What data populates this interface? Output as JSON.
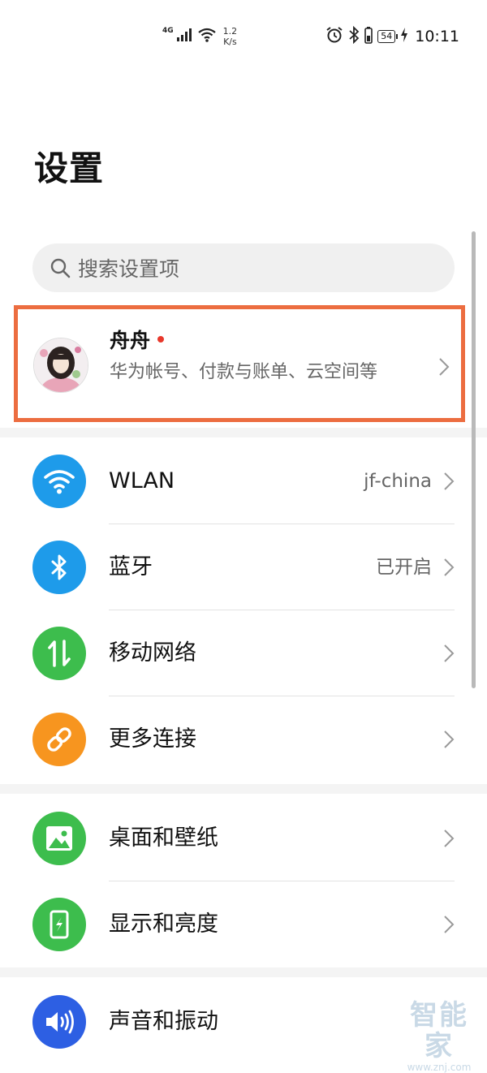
{
  "status_bar": {
    "network_label": "4G",
    "speed_value": "1.2",
    "speed_unit": "K/s",
    "battery": "54",
    "time": "10:11"
  },
  "page_title": "设置",
  "search": {
    "placeholder": "搜索设置项"
  },
  "account": {
    "name": "舟舟",
    "description": "华为帐号、付款与账单、云空间等"
  },
  "sections": [
    {
      "items": [
        {
          "label": "WLAN",
          "value": "jf-china",
          "icon": "wifi-icon",
          "color": "#1e9bea"
        },
        {
          "label": "蓝牙",
          "value": "已开启",
          "icon": "bluetooth-icon",
          "color": "#1e9bea"
        },
        {
          "label": "移动网络",
          "value": "",
          "icon": "mobile-network-icon",
          "color": "#3dbd4d"
        },
        {
          "label": "更多连接",
          "value": "",
          "icon": "link-icon",
          "color": "#f7951f"
        }
      ]
    },
    {
      "items": [
        {
          "label": "桌面和壁纸",
          "value": "",
          "icon": "wallpaper-icon",
          "color": "#3dbd4d"
        },
        {
          "label": "显示和亮度",
          "value": "",
          "icon": "display-icon",
          "color": "#3dbd4d"
        }
      ]
    },
    {
      "items": [
        {
          "label": "声音和振动",
          "value": "",
          "icon": "sound-icon",
          "color": "#2d5fe3"
        }
      ]
    }
  ],
  "watermark": {
    "brand": "智能家",
    "url": "www.znj.com"
  }
}
